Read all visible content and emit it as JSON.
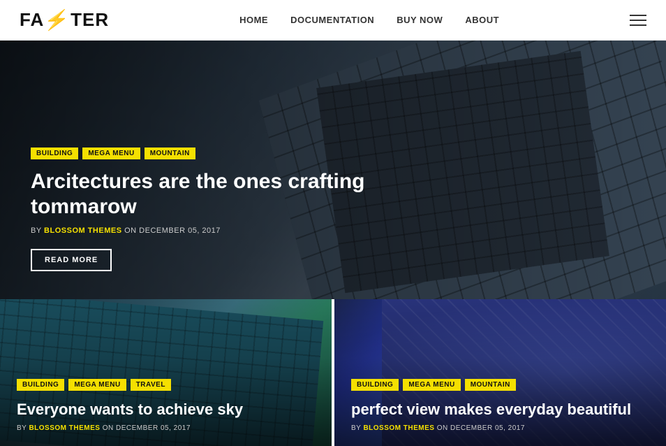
{
  "header": {
    "logo_prefix": "FA",
    "logo_bolt": "⚡",
    "logo_suffix": "TER",
    "nav": [
      {
        "label": "HOME",
        "href": "#"
      },
      {
        "label": "DOCUMENTATION",
        "href": "#"
      },
      {
        "label": "BUY NOW",
        "href": "#"
      },
      {
        "label": "ABOUT",
        "href": "#"
      }
    ]
  },
  "hero": {
    "tags": [
      "BUILDING",
      "MEGA MENU",
      "MOUNTAIN"
    ],
    "title": "Arcitectures are the ones crafting tommarow",
    "meta_prefix": "BY",
    "meta_author": "BLOSSOM THEMES",
    "meta_on": "ON DECEMBER 05, 2017",
    "read_more": "READ MORE"
  },
  "cards": [
    {
      "tags": [
        "BUILDING",
        "MEGA MENU",
        "TRAVEL"
      ],
      "title": "Everyone wants to achieve sky",
      "meta_prefix": "BY",
      "meta_author": "BLOSSOM THEMES",
      "meta_on": "ON DECEMBER 05, 2017"
    },
    {
      "tags": [
        "BUILDING",
        "MEGA MENU",
        "MOUNTAIN"
      ],
      "title": "perfect view makes everyday beautiful",
      "meta_prefix": "BY",
      "meta_author": "BLOSSOM THEMES",
      "meta_on": "ON DECEMBER 05, 2017"
    }
  ]
}
